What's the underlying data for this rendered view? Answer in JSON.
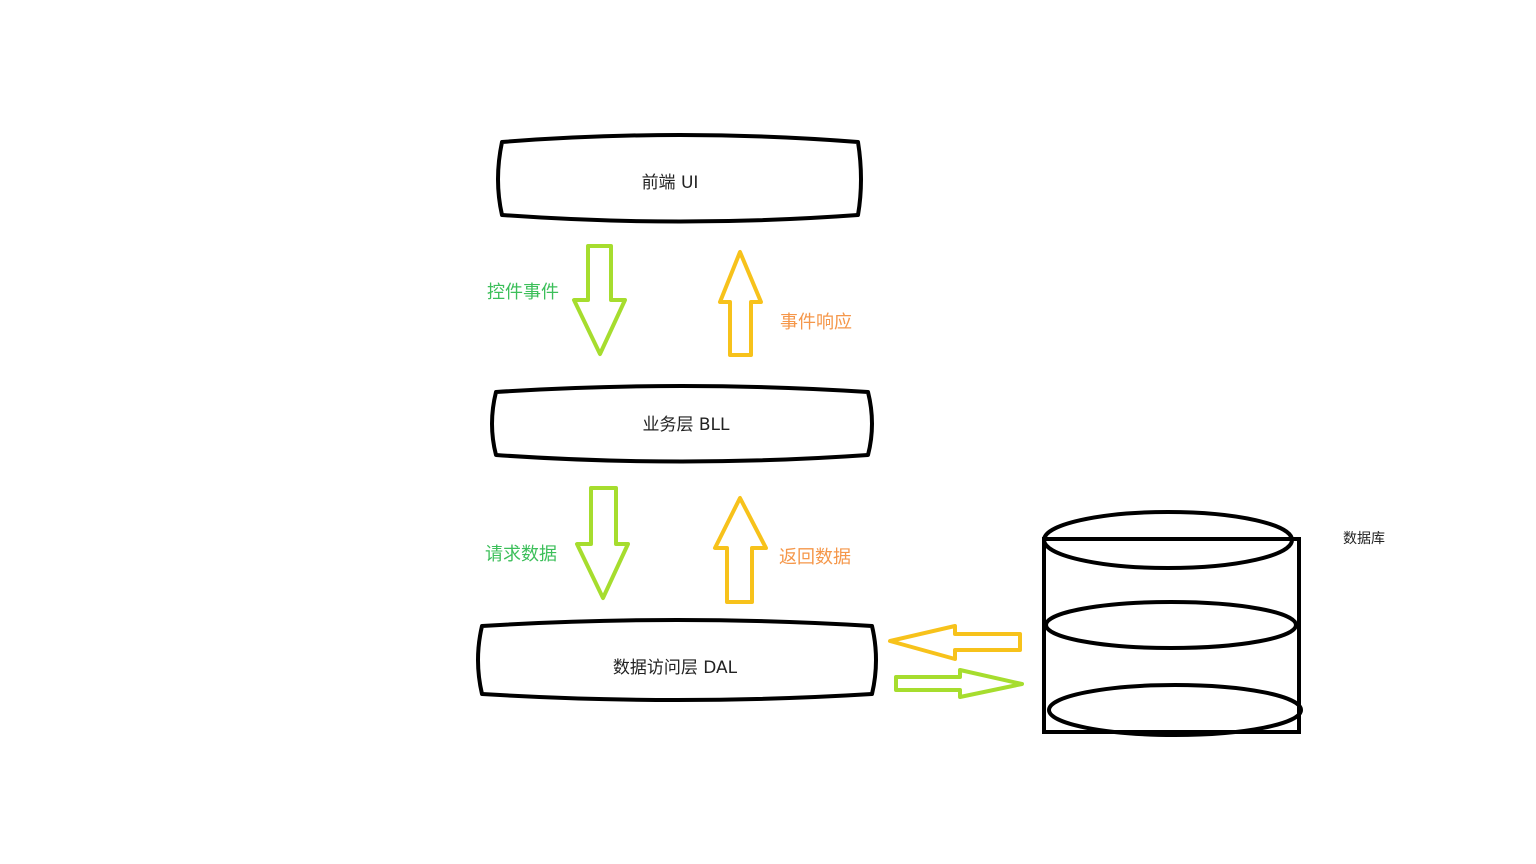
{
  "layers": {
    "ui": {
      "label": "前端 UI"
    },
    "bll": {
      "label": "业务层 BLL"
    },
    "dal": {
      "label": "数据访问层 DAL"
    }
  },
  "flows": {
    "ui_to_bll": {
      "label": "控件事件"
    },
    "bll_to_ui": {
      "label": "事件响应"
    },
    "bll_to_dal": {
      "label": "请求数据"
    },
    "dal_to_bll": {
      "label": "返回数据"
    }
  },
  "database": {
    "label": "数据库"
  },
  "colors": {
    "request_arrow": "#a6dd2e",
    "response_arrow": "#f7c21b",
    "request_text": "#3cbf5a",
    "response_text": "#f5974a",
    "outline": "#000000"
  }
}
